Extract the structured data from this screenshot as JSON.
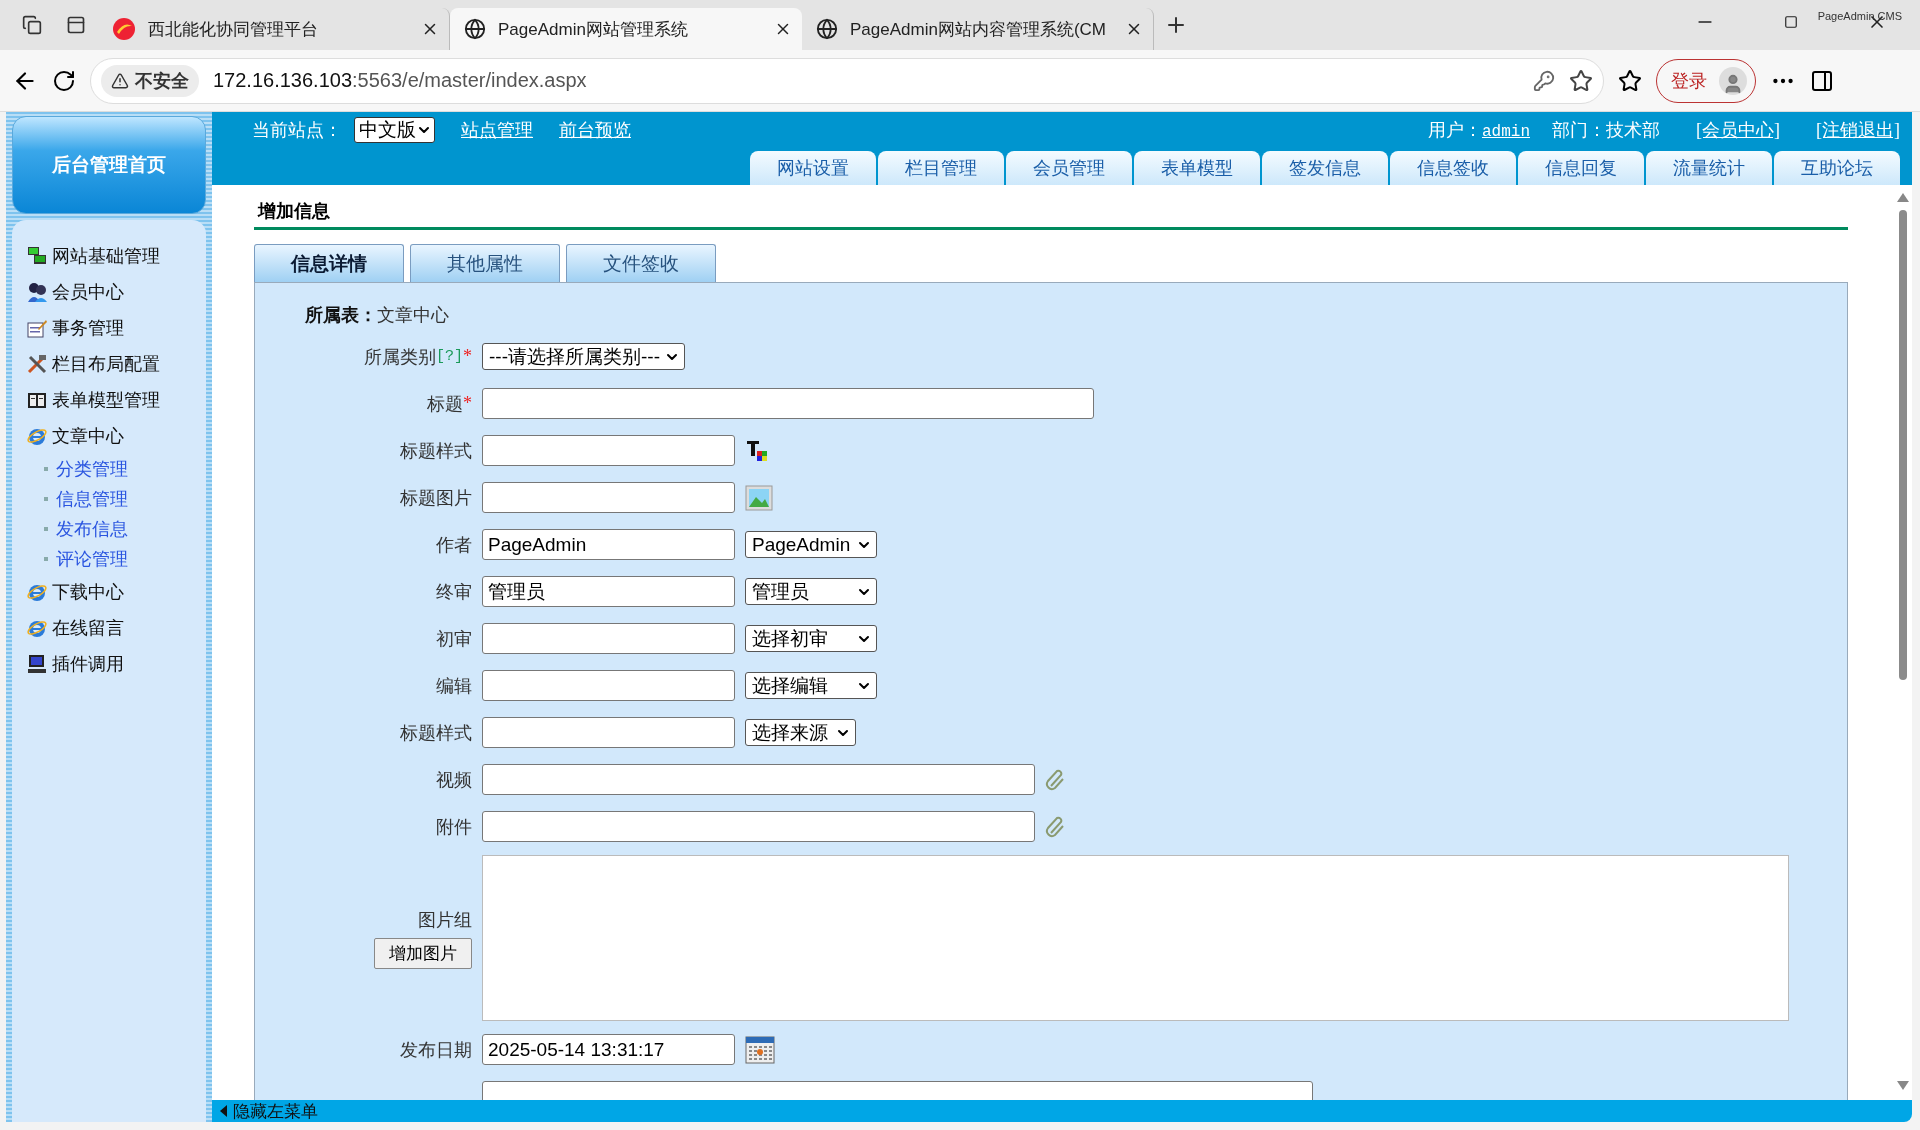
{
  "browser": {
    "tabs": [
      {
        "title": "西北能化协同管理平台",
        "selected": false,
        "kind": "logo"
      },
      {
        "title": "PageAdmin网站管理系统",
        "selected": true,
        "kind": "globe"
      },
      {
        "title": "PageAdmin网站内容管理系统(CM",
        "selected": false,
        "kind": "globe"
      }
    ],
    "overlay_text": "PageAdmin CMS",
    "address": {
      "security": "不安全",
      "host": "172.16.136.103",
      "path": ":5563/e/master/index.aspx"
    },
    "login": "登录"
  },
  "header": {
    "site_label": "当前站点：",
    "site_select": "中文版",
    "links": [
      "站点管理",
      "前台预览"
    ],
    "user_label": "用户：",
    "user": "admin",
    "dept": "部门：技术部",
    "member": "[会员中心]",
    "logout": "[注销退出]",
    "nav_tabs": [
      "网站设置",
      "栏目管理",
      "会员管理",
      "表单模型",
      "签发信息",
      "信息签收",
      "信息回复",
      "流量统计",
      "互助论坛"
    ]
  },
  "sidebar": {
    "home": "后台管理首页",
    "items": [
      {
        "label": "网站基础管理",
        "kind": "computers"
      },
      {
        "label": "会员中心",
        "kind": "people"
      },
      {
        "label": "事务管理",
        "kind": "notepad"
      },
      {
        "label": "栏目布局配置",
        "kind": "tools"
      },
      {
        "label": "表单模型管理",
        "kind": "book"
      },
      {
        "label": "文章中心",
        "kind": "browser",
        "children": [
          {
            "label": "分类管理"
          },
          {
            "label": "信息管理"
          },
          {
            "label": "发布信息"
          },
          {
            "label": "评论管理"
          }
        ]
      },
      {
        "label": "下载中心",
        "kind": "browser"
      },
      {
        "label": "在线留言",
        "kind": "browser"
      },
      {
        "label": "插件调用",
        "kind": "monitor"
      }
    ]
  },
  "content": {
    "title": "增加信息",
    "tabs": [
      {
        "label": "信息详情",
        "selected": true
      },
      {
        "label": "其他属性",
        "selected": false
      },
      {
        "label": "文件签收",
        "selected": false
      }
    ],
    "table_info": {
      "label": "所属表：",
      "value": "文章中心"
    },
    "fields": [
      {
        "kind": "category",
        "label": "所属类别",
        "help": "[?]",
        "required_mark": "*",
        "select": "---请选择所属类别---"
      },
      {
        "kind": "wide",
        "label": "标题",
        "required_mark": "*"
      },
      {
        "kind": "color_picker",
        "label": "标题样式"
      },
      {
        "kind": "image_picker",
        "label": "标题图片"
      },
      {
        "kind": "with_select",
        "label": "作者",
        "value": "PageAdmin",
        "select": "PageAdmin"
      },
      {
        "kind": "with_select",
        "label": "终审",
        "value": "管理员",
        "select": "管理员"
      },
      {
        "kind": "with_select",
        "label": "初审",
        "select": "选择初审"
      },
      {
        "kind": "with_select",
        "label": "编辑",
        "select": "选择编辑"
      },
      {
        "kind": "with_select",
        "label": "标题样式",
        "select": "选择来源",
        "narrow": true
      },
      {
        "kind": "file",
        "label": "视频"
      },
      {
        "kind": "file",
        "label": "附件"
      },
      {
        "kind": "gallery",
        "label": "图片组",
        "button": "增加图片"
      },
      {
        "kind": "date",
        "label": "发布日期",
        "value": "2025-05-14 13:31:17"
      },
      {
        "kind": "partial"
      }
    ]
  },
  "footer": {
    "toggle": "隐藏左菜单"
  }
}
